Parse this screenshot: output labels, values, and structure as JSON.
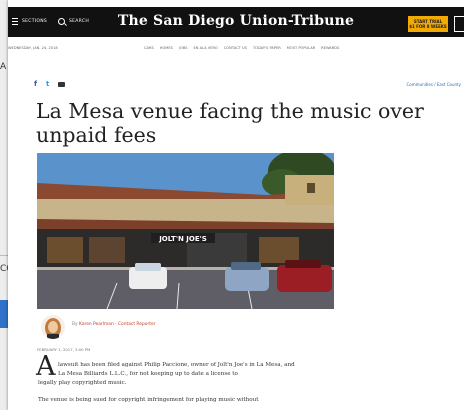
{
  "background_window": {
    "label_a": "A",
    "label_co": "CO"
  },
  "masthead": {
    "sections_label": "SECTIONS",
    "search_label": "SEARCH",
    "logo": "The San Diego Union-Tribune",
    "cta_line1": "START TRIAL",
    "cta_line2": "$1 FOR 8 WEEKS"
  },
  "subbar": {
    "date": "WEDNESDAY, JAN. 24, 2018",
    "links": [
      "CARS",
      "HOMES",
      "JOBS",
      "EN ALA VERO",
      "CONTACT US",
      "TODAY'S PAPER",
      "MOST POPULAR",
      "REWARDS"
    ]
  },
  "social": {
    "facebook": "f",
    "twitter": "t"
  },
  "breadcrumb": "Communities / East County",
  "article": {
    "headline": "La Mesa venue facing the music over unpaid fees",
    "photo_sign": "JOLT'N JOE'S",
    "byline_prefix": "By",
    "byline_name": "Karen Pearlman · Contact Reporter",
    "timestamp": "FEBRUARY 1, 2017, 3:00 PM",
    "dropcap": "A",
    "para1_line1": "lawsuit has been filed against Philip Paccione, owner of Jolt'n Joe's in La Mesa, and",
    "para1_line2": "La Mesa Billiards L.L.C., for not keeping up to date a license to",
    "para1_line3": "legally play copyrighted music.",
    "para2_line1": "The venue is being sued for copyright infringement for playing music without"
  },
  "colors": {
    "masthead": "#111111",
    "cta": "#f2a900",
    "link": "#2a6fb8",
    "byline_name": "#c03c2e"
  }
}
